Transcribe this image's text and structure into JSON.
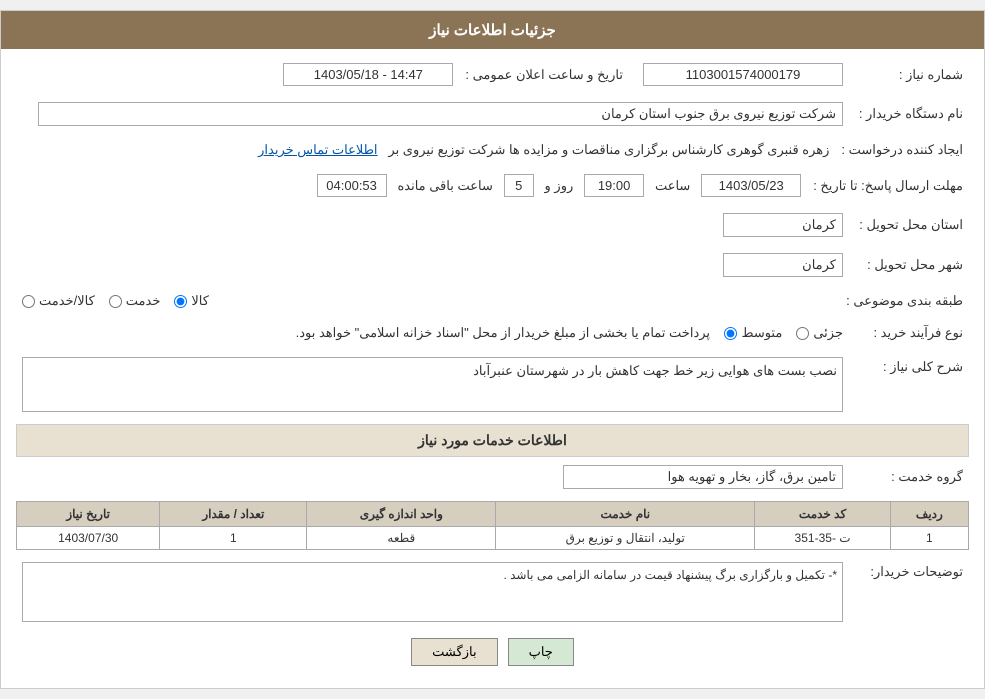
{
  "header": {
    "title": "جزئیات اطلاعات نیاز"
  },
  "fields": {
    "shomareNiaz_label": "شماره نیاز :",
    "shomareNiaz_value": "1103001574000179",
    "namDastgah_label": "نام دستگاه خریدار :",
    "namDastgah_value": "شرکت توزیع نیروی برق جنوب استان کرمان",
    "ijadKonande_label": "ایجاد کننده درخواست :",
    "ijadKonande_value": "زهره قنبری گوهری کارشناس برگزاری مناقصات و مزایده ها شرکت توزیع نیروی بر",
    "ijadKonande_link": "اطلاعات تماس خریدار",
    "mohlatErsal_label": "مهلت ارسال پاسخ: تا تاریخ :",
    "taarikh_value": "1403/05/23",
    "saat_label": "ساعت",
    "saat_value": "19:00",
    "roz_label": "روز و",
    "roz_value": "5",
    "baghiMande_label": "ساعت باقی مانده",
    "baghiMande_value": "04:00:53",
    "tarikh_elan_label": "تاریخ و ساعت اعلان عمومی :",
    "tarikh_elan_value": "1403/05/18 - 14:47",
    "ostanTahvil_label": "استان محل تحویل :",
    "ostanTahvil_value": "کرمان",
    "shahrTahvil_label": "شهر محل تحویل :",
    "shahrTahvil_value": "کرمان",
    "tabaqeBandi_label": "طبقه بندی موضوعی :",
    "tabaqeBandi_options": [
      "کالا",
      "خدمت",
      "کالا/خدمت"
    ],
    "tabaqeBandi_selected": "کالا",
    "noeFarayand_label": "نوع فرآیند خرید :",
    "noeFarayand_options": [
      "جزئی",
      "متوسط"
    ],
    "noeFarayand_selected": "متوسط",
    "noeFarayand_note": "پرداخت تمام یا بخشی از مبلغ خریدار از محل \"اسناد خزانه اسلامی\" خواهد بود.",
    "sharhKoli_label": "شرح کلی نیاز :",
    "sharhKoli_value": "نصب بست های هوایی زیر خط جهت کاهش بار در شهرستان عنبرآباد",
    "khadamat_section": "اطلاعات خدمات مورد نیاز",
    "groohKhadamat_label": "گروه خدمت :",
    "groohKhadamat_value": "تامین برق، گاز، بخار و تهویه هوا",
    "table": {
      "headers": [
        "ردیف",
        "کد خدمت",
        "نام خدمت",
        "واحد اندازه گیری",
        "تعداد / مقدار",
        "تاریخ نیاز"
      ],
      "rows": [
        {
          "radif": "1",
          "kodKhadamat": "ت -35-351",
          "namKhadamat": "تولید، انتقال و توزیع برق",
          "vahed": "قطعه",
          "tedad": "1",
          "tarikh": "1403/07/30"
        }
      ]
    },
    "tozihat_label": "توضیحات خریدار:",
    "tozihat_value": "*- تکمیل و بارگزاری برگ پیشنهاد قیمت در سامانه الزامی می باشد ."
  },
  "buttons": {
    "print": "چاپ",
    "back": "بازگشت"
  }
}
